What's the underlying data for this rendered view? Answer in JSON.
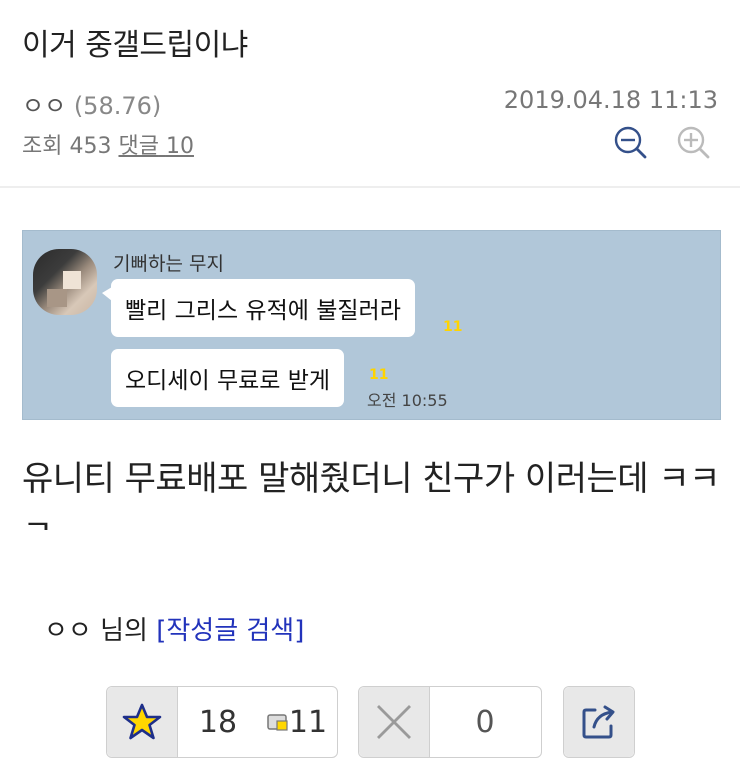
{
  "post": {
    "title": "이거 중갤드립이냐",
    "author": "ㅇㅇ",
    "author_score": "(58.76)",
    "date": "2019.04.18 11:13",
    "views_label": "조회",
    "views": "453",
    "comments_label": "댓글",
    "comments": "10"
  },
  "chat": {
    "sender": "기뻐하는 무지",
    "message1": "빨리 그리스 유적에 불질러라",
    "message2": "오디세이 무료로 받게",
    "unread1": "11",
    "unread2": "11",
    "time": "오전 10:55"
  },
  "body": {
    "text": "유니티 무료배포 말해줬더니 친구가 이러는데 ㅋㅋㅋ"
  },
  "author_search": {
    "name": "ㅇㅇ",
    "suffix": "님의",
    "link": "[작성글 검색]"
  },
  "buttons": {
    "recommend_count": "18",
    "fixed_count": "11",
    "dislike_count": "0"
  },
  "icons": {
    "zoom_out": "zoom-out-icon",
    "zoom_in": "zoom-in-icon",
    "recommend": "star-icon",
    "fixed": "fixed-nick-icon",
    "dislike": "x-icon",
    "share": "share-icon"
  },
  "colors": {
    "chat_bg": "#b1c7d9",
    "link": "#2233bb",
    "star": "#ffd700",
    "icon_blue": "#34508a"
  }
}
